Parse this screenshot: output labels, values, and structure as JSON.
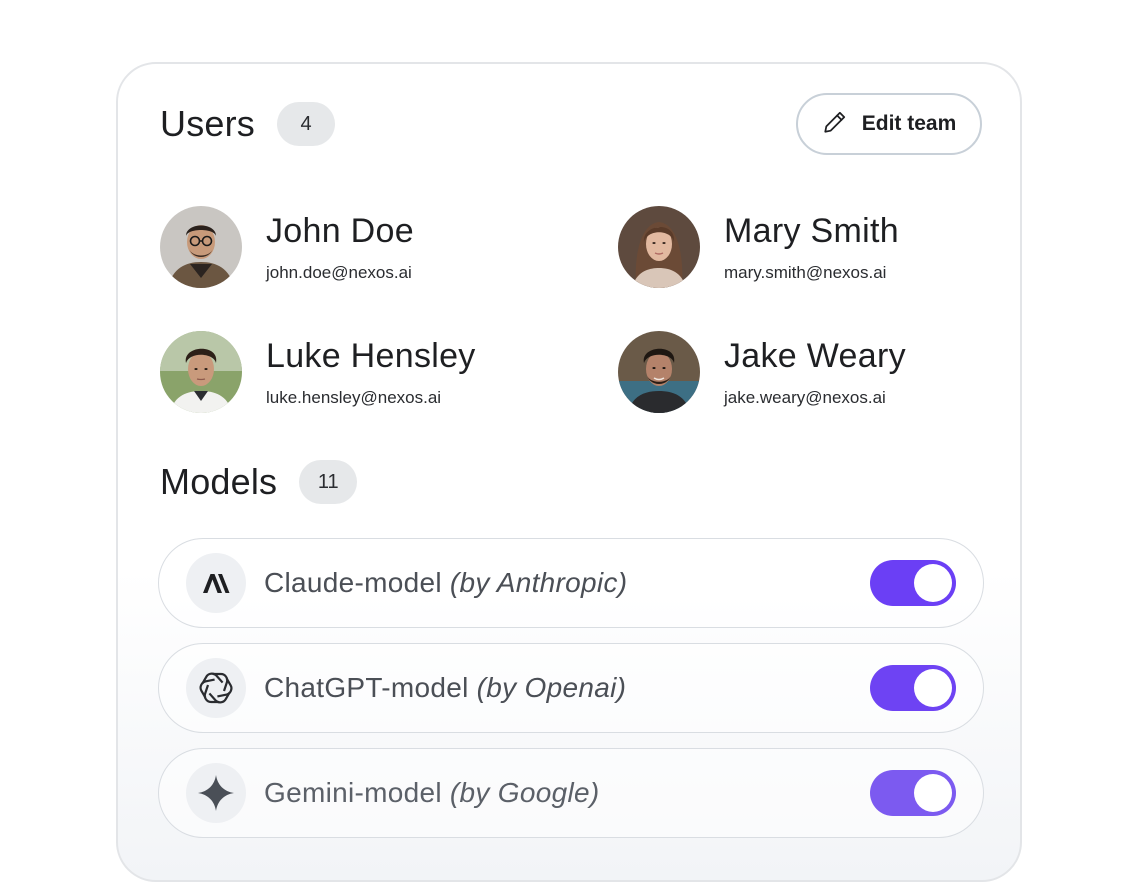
{
  "users_section": {
    "title": "Users",
    "count": "4",
    "edit_button_label": "Edit team",
    "edit_icon": "pencil-icon",
    "users": [
      {
        "name": "John Doe",
        "email": "john.doe@nexos.ai"
      },
      {
        "name": "Mary Smith",
        "email": "mary.smith@nexos.ai"
      },
      {
        "name": "Luke Hensley",
        "email": "luke.hensley@nexos.ai"
      },
      {
        "name": "Jake Weary",
        "email": "jake.weary@nexos.ai"
      }
    ]
  },
  "models_section": {
    "title": "Models",
    "count": "11",
    "models": [
      {
        "name": "Claude-model",
        "provider": "(by Anthropic)",
        "icon": "anthropic-logo-icon",
        "enabled": true
      },
      {
        "name": "ChatGPT-model",
        "provider": "(by Openai)",
        "icon": "openai-logo-icon",
        "enabled": true
      },
      {
        "name": "Gemini-model",
        "provider": "(by Google)",
        "icon": "gemini-logo-icon",
        "enabled": true
      }
    ]
  },
  "colors": {
    "toggle_on": "#6b3ff5",
    "badge_bg": "#e6e8ea",
    "card_border": "#e3e5e8"
  }
}
